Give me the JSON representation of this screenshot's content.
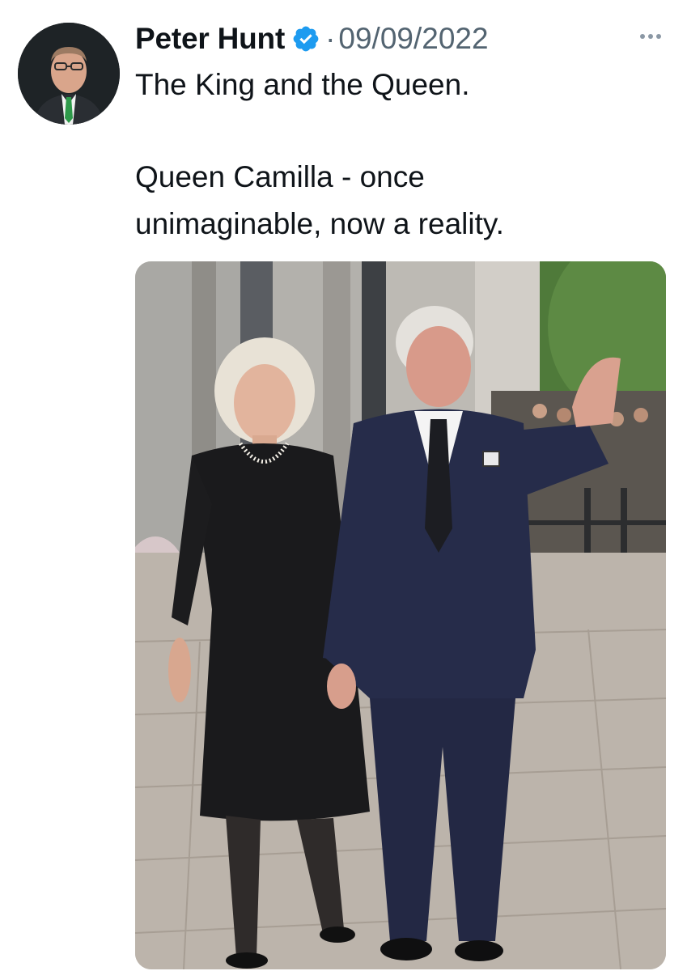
{
  "tweet": {
    "author_name": "Peter Hunt",
    "separator": "·",
    "date": "09/09/2022",
    "text_lines": [
      "The King and the Queen.",
      "Queen Camilla - once",
      "unimaginable, now a reality."
    ],
    "more_icon": "more-horizontal-icon",
    "verified_icon": "verified-badge-icon"
  },
  "colors": {
    "verified_blue": "#1d9bf0",
    "secondary_text": "#536471",
    "primary_text": "#0f1419"
  }
}
